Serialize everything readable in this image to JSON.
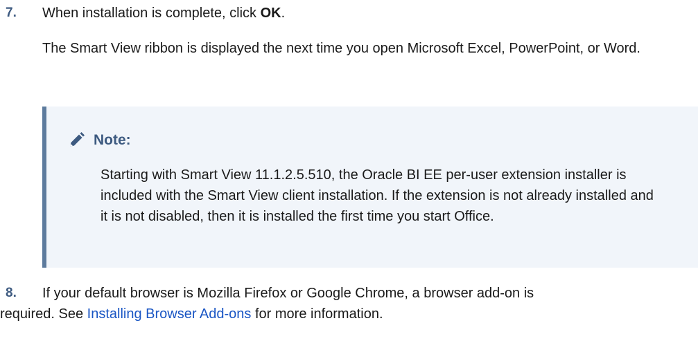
{
  "step7": {
    "number": "7.",
    "line_prefix": "When installation is complete, click ",
    "line_bold": "OK",
    "line_suffix": ".",
    "paragraph": "The Smart View ribbon is displayed the next time you open Microsoft Excel, PowerPoint, or Word."
  },
  "note": {
    "icon": "pencil-icon",
    "title": "Note:",
    "text": "Starting with Smart View 11.1.2.5.510, the Oracle BI EE per-user extension installer is included with the Smart View client installation. If the extension is not already installed and it is not disabled, then it is installed the first time you start Office."
  },
  "step8": {
    "number": "8.",
    "line1": "If your default browser is Mozilla Firefox or Google Chrome, a browser add-on is",
    "line2_prefix": "required. See ",
    "link_text": "Installing Browser Add-ons",
    "line2_suffix": " for more information."
  },
  "colors": {
    "step_number": "#3d5a80",
    "note_background": "#f1f5fa",
    "note_border": "#5d7b9d",
    "link": "#1a56c4"
  }
}
